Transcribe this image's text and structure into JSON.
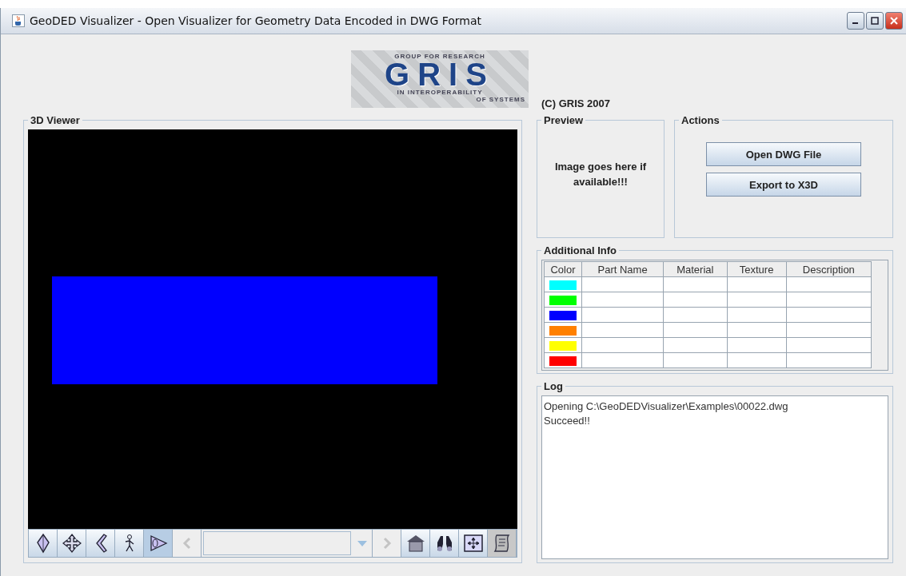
{
  "window": {
    "title": "GeoDED Visualizer - Open Visualizer for Geometry Data Encoded in DWG Format"
  },
  "logo": {
    "top_line": "GROUP FOR RESEARCH",
    "name": "GRIS",
    "line_2": "IN INTEROPERABILITY",
    "line_3": "OF SYSTEMS"
  },
  "copyright": "(C) GRIS 2007",
  "viewer": {
    "title": "3D Viewer",
    "toolbar": {
      "left_buttons": [
        {
          "selected": false
        },
        {
          "selected": false
        },
        {
          "selected": false
        },
        {
          "selected": false
        },
        {
          "selected": true
        }
      ],
      "prev": {
        "disabled": true
      },
      "next": {
        "disabled": true
      },
      "right_buttons": [
        {
          "selected": false
        },
        {
          "selected": false
        },
        {
          "selected": false
        },
        {
          "selected": true
        }
      ]
    }
  },
  "preview": {
    "title": "Preview",
    "text": "Image goes here if available!!!"
  },
  "actions": {
    "title": "Actions",
    "buttons": [
      "Open DWG File",
      "Export to X3D"
    ]
  },
  "info": {
    "title": "Additional Info",
    "columns": [
      "Color",
      "Part Name",
      "Material",
      "Texture",
      "Description"
    ],
    "rows": [
      {
        "color": "#00ffff"
      },
      {
        "color": "#00ff00"
      },
      {
        "color": "#0000ff"
      },
      {
        "color": "#ff8000"
      },
      {
        "color": "#ffff00"
      },
      {
        "color": "#ff0000"
      }
    ]
  },
  "log": {
    "title": "Log",
    "lines": [
      "Opening C:\\GeoDEDVisualizer\\Examples\\00022.dwg",
      "Succeed!!"
    ]
  }
}
